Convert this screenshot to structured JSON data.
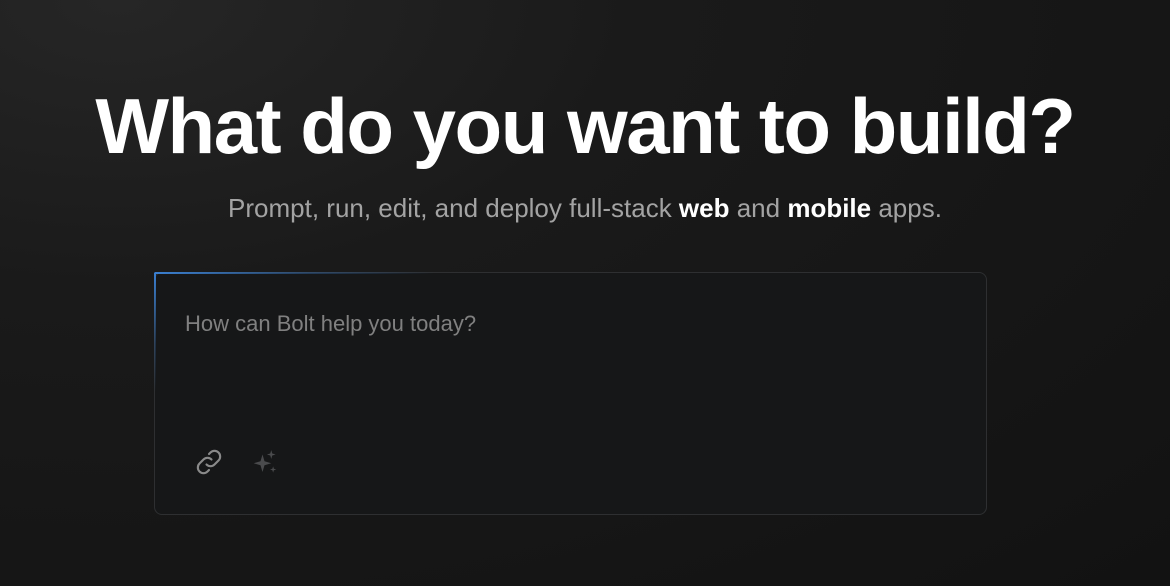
{
  "hero": {
    "title": "What do you want to build?",
    "subtitle_prefix": "Prompt, run, edit, and deploy full-stack ",
    "subtitle_web": "web",
    "subtitle_and": " and ",
    "subtitle_mobile": "mobile",
    "subtitle_suffix": " apps."
  },
  "prompt": {
    "placeholder": "How can Bolt help you today?",
    "value": ""
  },
  "toolbar": {
    "attach_icon": "link-icon",
    "enhance_icon": "sparkles-icon"
  },
  "colors": {
    "background": "#121212",
    "accent": "#3a7fd0",
    "icon": "#8a8a8a",
    "icon_dim": "#4a4b4d"
  }
}
